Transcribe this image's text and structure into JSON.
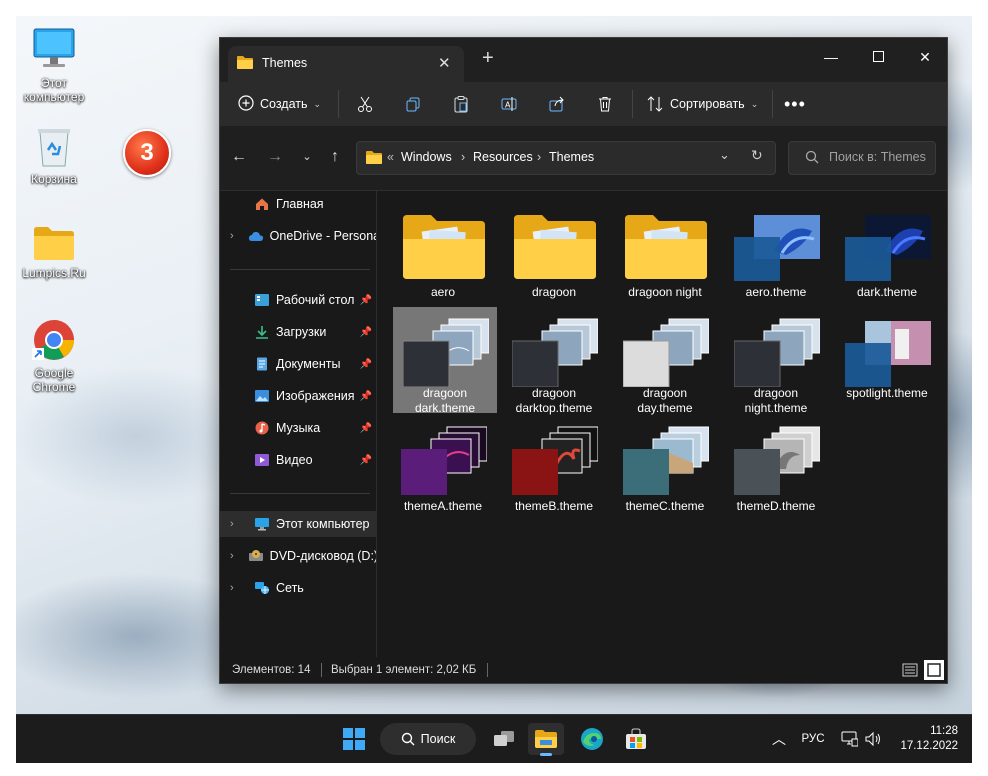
{
  "desktop": {
    "icons": [
      {
        "label": "Этот\nкомпьютер"
      },
      {
        "label": "Корзина"
      },
      {
        "label": "Lumpics.Ru"
      },
      {
        "label": "Google\nChrome"
      }
    ],
    "step_badge": "3"
  },
  "explorer": {
    "tab_title": "Themes",
    "toolbar": {
      "create_label": "Создать",
      "sort_label": "Сортировать"
    },
    "address": {
      "overflow": "«",
      "crumbs": [
        "Windows",
        "Resources",
        "Themes"
      ]
    },
    "search_placeholder": "Поиск в: Themes",
    "sidebar": {
      "items": [
        {
          "label": "Главная"
        },
        {
          "label": "OneDrive - Personal"
        },
        {
          "label": "Рабочий стол"
        },
        {
          "label": "Загрузки"
        },
        {
          "label": "Документы"
        },
        {
          "label": "Изображения"
        },
        {
          "label": "Музыка"
        },
        {
          "label": "Видео"
        },
        {
          "label": "Этот компьютер"
        },
        {
          "label": "DVD-дисковод (D:)"
        },
        {
          "label": "Сеть"
        }
      ]
    },
    "files": [
      {
        "name": "aero",
        "kind": "folder"
      },
      {
        "name": "dragoon",
        "kind": "folder"
      },
      {
        "name": "dragoon night",
        "kind": "folder"
      },
      {
        "name": "aero.theme",
        "kind": "theme"
      },
      {
        "name": "dark.theme",
        "kind": "theme"
      },
      {
        "name": "dragoon\ndark.theme",
        "kind": "stack",
        "selected": true
      },
      {
        "name": "dragoon\ndarktop.theme",
        "kind": "stack"
      },
      {
        "name": "dragoon\nday.theme",
        "kind": "stack"
      },
      {
        "name": "dragoon\nnight.theme",
        "kind": "stack"
      },
      {
        "name": "spotlight.theme",
        "kind": "theme"
      },
      {
        "name": "themeA.theme",
        "kind": "stack"
      },
      {
        "name": "themeB.theme",
        "kind": "stack"
      },
      {
        "name": "themeC.theme",
        "kind": "stack"
      },
      {
        "name": "themeD.theme",
        "kind": "stack"
      }
    ],
    "status": {
      "count": "Элементов: 14",
      "selected": "Выбран 1 элемент: 2,02 КБ"
    }
  },
  "taskbar": {
    "search_label": "Поиск",
    "language": "РУС",
    "time": "11:28",
    "date": "17.12.2022"
  }
}
